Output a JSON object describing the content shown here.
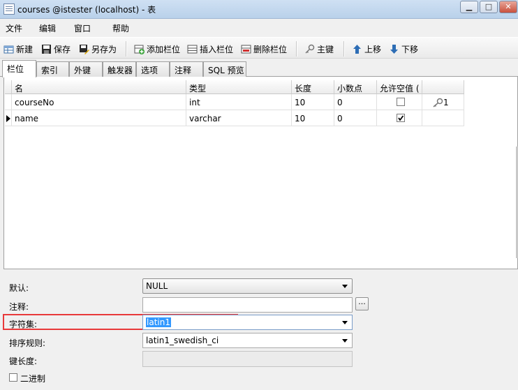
{
  "window": {
    "title": "courses @istester (localhost) - 表"
  },
  "menu": [
    "文件",
    "编辑",
    "窗口",
    "帮助"
  ],
  "toolbar": {
    "new": "新建",
    "save": "保存",
    "save_as": "另存为",
    "add_field": "添加栏位",
    "insert_field": "插入栏位",
    "delete_field": "删除栏位",
    "primary_key": "主键",
    "move_up": "上移",
    "move_down": "下移"
  },
  "tabs": [
    "栏位",
    "索引",
    "外键",
    "触发器",
    "选项",
    "注释",
    "SQL 预览"
  ],
  "grid": {
    "headers": [
      "名",
      "类型",
      "长度",
      "小数点",
      "允许空值 ("
    ],
    "rows": [
      {
        "name": "courseNo",
        "type": "int",
        "length": "10",
        "decimals": "0",
        "allow_null": false,
        "key": "1"
      },
      {
        "name": "name",
        "type": "varchar",
        "length": "10",
        "decimals": "0",
        "allow_null": true,
        "key": ""
      }
    ]
  },
  "props": {
    "default_label": "默认:",
    "default_value": "NULL",
    "comment_label": "注释:",
    "comment_button": "...",
    "charset_label": "字符集:",
    "charset_value": "latin1",
    "collation_label": "排序规则:",
    "collation_value": "latin1_swedish_ci",
    "keylen_label": "键长度:",
    "binary_label": "二进制"
  },
  "colors": {
    "highlight_box": "#e8393a",
    "selection": "#3399ff"
  }
}
